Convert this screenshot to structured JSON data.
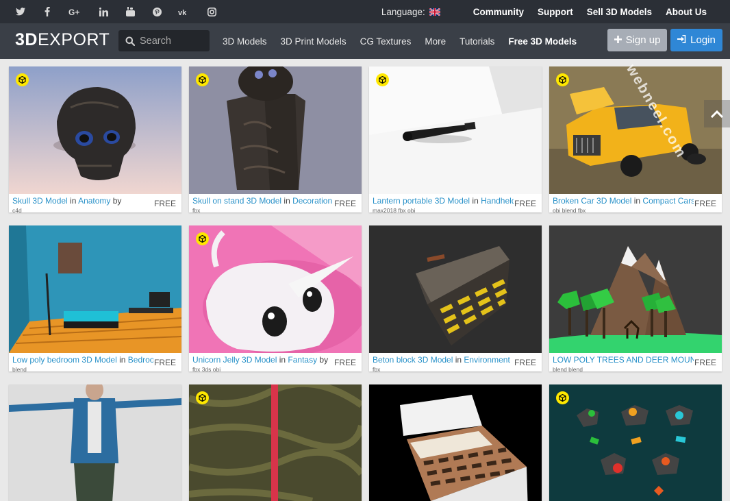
{
  "social_icons": [
    "twitter-icon",
    "facebook-icon",
    "google-plus-icon",
    "linkedin-icon",
    "youtube-icon",
    "pinterest-icon",
    "vk-icon",
    "instagram-icon"
  ],
  "topbar": {
    "language_label": "Language:",
    "links": [
      "Community",
      "Support",
      "Sell 3D Models",
      "About Us"
    ]
  },
  "navbar": {
    "logo_bold": "3D",
    "logo_rest": "EXPORT",
    "search_placeholder": "Search",
    "links": [
      "3D Models",
      "3D Print Models",
      "CG Textures",
      "More",
      "Tutorials",
      "Free 3D Models"
    ],
    "signup": "Sign up",
    "login": "Login"
  },
  "cards": [
    {
      "title": "Skull 3D Model",
      "in": " in ",
      "category": "Anatomy",
      "by": " by",
      "formats": "c4d",
      "price": "FREE"
    },
    {
      "title": "Skull on stand 3D Model",
      "in": " in ",
      "category": "Decoration",
      "by": "",
      "formats": "fbx",
      "price": "FREE"
    },
    {
      "title": "Lantern portable 3D Model",
      "in": " in ",
      "category": "Handheld",
      "by": "",
      "formats": "max2018 fbx obj",
      "price": "FREE"
    },
    {
      "title": "Broken Car 3D Model",
      "in": " in ",
      "category": "Compact Cars",
      "by": "",
      "formats": "obj blend fbx",
      "price": "FREE"
    },
    {
      "title": "Low poly bedroom 3D Model",
      "in": " in ",
      "category": "Bedroom",
      "by": "",
      "formats": "blend",
      "price": "FREE"
    },
    {
      "title": "Unicorn Jelly 3D Model",
      "in": " in ",
      "category": "Fantasy",
      "by": " by",
      "formats": "fbx 3ds obj",
      "price": "FREE"
    },
    {
      "title": "Beton block 3D Model",
      "in": " in ",
      "category": "Environment",
      "by": "",
      "formats": "fbx",
      "price": "FREE"
    },
    {
      "title": "LOW POLY TREES AND DEER MOUNTAIN",
      "in": "",
      "category": "",
      "by": "",
      "formats": "blend blend",
      "price": "FREE"
    }
  ],
  "watermark": "webneel.com",
  "colors": {
    "accent": "#2f87d6",
    "link": "#2a92c9",
    "badge": "#ffe800",
    "topbar": "#2b2f36",
    "navbar": "#3a3f47"
  }
}
